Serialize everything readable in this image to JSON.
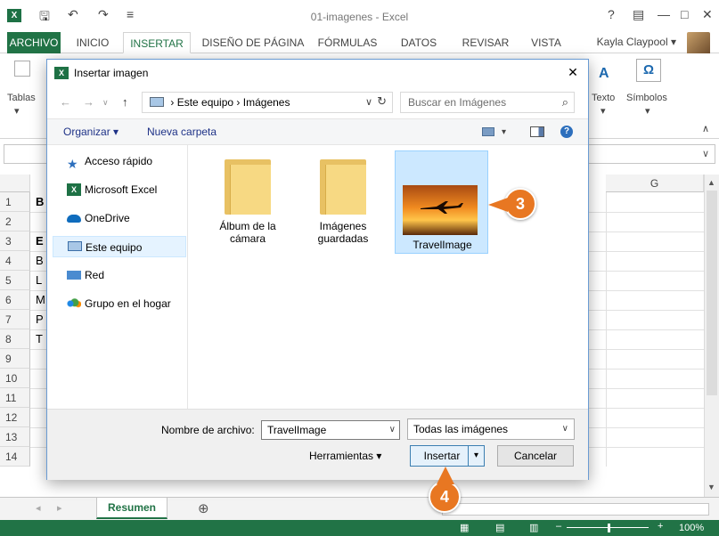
{
  "window": {
    "title": "01-imagenes - Excel",
    "help": "?",
    "ribbon_display": "▤",
    "minimize": "—",
    "maximize": "□",
    "close": "✕"
  },
  "quick_access": {
    "save_icon": "💾",
    "undo": "↶",
    "redo": "↷",
    "more": "≡"
  },
  "tabs": [
    {
      "label": "ARCHIVO"
    },
    {
      "label": "INICIO"
    },
    {
      "label": "INSERTAR"
    },
    {
      "label": "DISEÑO DE PÁGINA"
    },
    {
      "label": "FÓRMULAS"
    },
    {
      "label": "DATOS"
    },
    {
      "label": "REVISAR"
    },
    {
      "label": "VISTA"
    }
  ],
  "user": {
    "name": "Kayla Claypool",
    "caret": "▾"
  },
  "ribbon": {
    "tables_label": "Tablas",
    "text_label": "Texto",
    "symbols_label": "Símbolos",
    "omega": "Ω",
    "caret": "▾",
    "collapse": "∧"
  },
  "grid": {
    "columns": [
      "G"
    ],
    "rows": [
      "1",
      "2",
      "3",
      "4",
      "5",
      "6",
      "7",
      "8",
      "9",
      "10",
      "11",
      "12",
      "13",
      "14"
    ],
    "cells": [
      "B",
      "",
      "E",
      "B",
      "L",
      "M",
      "P",
      "T"
    ]
  },
  "sheet": {
    "tab_label": "Resumen",
    "add": "⊕"
  },
  "status": {
    "zoom": "100%",
    "minus": "–",
    "plus": "+"
  },
  "dialog": {
    "title": "Insertar imagen",
    "close": "✕",
    "nav": {
      "back": "←",
      "forward": "→",
      "recent": "∨",
      "up": "↑"
    },
    "address": {
      "separator": "›",
      "part1": "Este equipo",
      "part2": "Imágenes",
      "dropdown": "∨",
      "refresh": "↻"
    },
    "search": {
      "placeholder": "Buscar en Imágenes",
      "icon": "⌕"
    },
    "toolbar": {
      "organize": "Organizar ▾",
      "new_folder": "Nueva carpeta",
      "view_caret": "▾",
      "help": "?"
    },
    "nav_pane": [
      {
        "label": "Acceso rápido"
      },
      {
        "label": "Microsoft Excel"
      },
      {
        "label": "OneDrive"
      },
      {
        "label": "Este equipo"
      },
      {
        "label": "Red"
      },
      {
        "label": "Grupo en el hogar"
      }
    ],
    "files": [
      {
        "label": "Álbum de la cámara",
        "type": "folder"
      },
      {
        "label": "Imágenes guardadas",
        "type": "folder"
      },
      {
        "label": "TravelImage",
        "type": "image"
      }
    ],
    "filename_label": "Nombre de archivo:",
    "filename_value": "TravelImage",
    "filter_value": "Todas las imágenes",
    "tools_label": "Herramientas",
    "insert_label": "Insertar",
    "cancel_label": "Cancelar",
    "dd_caret": "∨"
  },
  "callouts": [
    "3",
    "4"
  ]
}
